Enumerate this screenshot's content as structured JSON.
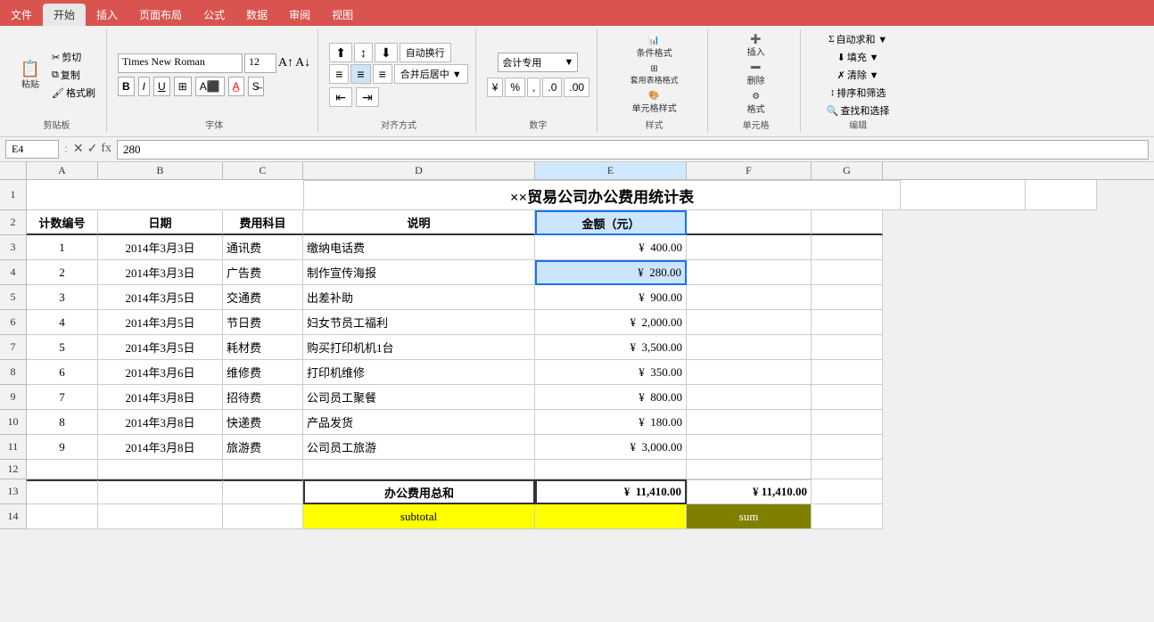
{
  "ribbon": {
    "tabs": [
      "文件",
      "开始",
      "插入",
      "页面布局",
      "公式",
      "数据",
      "审阅",
      "视图"
    ],
    "active_tab": "开始",
    "font_name": "Times New Roman",
    "font_size": "12",
    "groups": [
      {
        "label": "剪贴板",
        "buttons": [
          "剪切",
          "复制",
          "格式刷"
        ]
      },
      {
        "label": "字体"
      },
      {
        "label": "对齐方式"
      },
      {
        "label": "数字"
      },
      {
        "label": "样式"
      },
      {
        "label": "单元格"
      },
      {
        "label": "编辑"
      }
    ]
  },
  "formula_bar": {
    "cell_ref": "E4",
    "formula": "280"
  },
  "spreadsheet": {
    "col_headers": [
      "A",
      "B",
      "C",
      "D",
      "E",
      "F",
      "G"
    ],
    "row_headers": [
      "1",
      "2",
      "3",
      "4",
      "5",
      "6",
      "7",
      "8",
      "9",
      "10",
      "11",
      "12",
      "13",
      "14"
    ],
    "title": "××贸易公司办公费用统计表",
    "headers": {
      "col_a": "计数编号",
      "col_b": "日期",
      "col_c": "费用科目",
      "col_d": "说明",
      "col_e": "金额（元）"
    },
    "rows": [
      {
        "num": "1",
        "date": "2014年3月3日",
        "category": "通讯费",
        "desc": "缴纳电话费",
        "amount": "400.00"
      },
      {
        "num": "2",
        "date": "2014年3月3日",
        "category": "广告费",
        "desc": "制作宣传海报",
        "amount": "280.00"
      },
      {
        "num": "3",
        "date": "2014年3月5日",
        "category": "交通费",
        "desc": "出差补助",
        "amount": "900.00"
      },
      {
        "num": "4",
        "date": "2014年3月5日",
        "category": "节日费",
        "desc": "妇女节员工福利",
        "amount": "2,000.00"
      },
      {
        "num": "5",
        "date": "2014年3月5日",
        "category": "耗材费",
        "desc": "购买打印机机1台",
        "amount": "3,500.00"
      },
      {
        "num": "6",
        "date": "2014年3月6日",
        "category": "维修费",
        "desc": "打印机维修",
        "amount": "350.00"
      },
      {
        "num": "7",
        "date": "2014年3月8日",
        "category": "招待费",
        "desc": "公司员工聚餐",
        "amount": "800.00"
      },
      {
        "num": "8",
        "date": "2014年3月8日",
        "category": "快递费",
        "desc": "产品发货",
        "amount": "180.00"
      },
      {
        "num": "9",
        "date": "2014年3月8日",
        "category": "旅游费",
        "desc": "公司员工旅游",
        "amount": "3,000.00"
      }
    ],
    "total_label": "办公费用总和",
    "total_amount": "11,410.00",
    "total_f": "¥  11,410.00",
    "subtotal_label": "subtotal",
    "sum_label": "sum"
  }
}
